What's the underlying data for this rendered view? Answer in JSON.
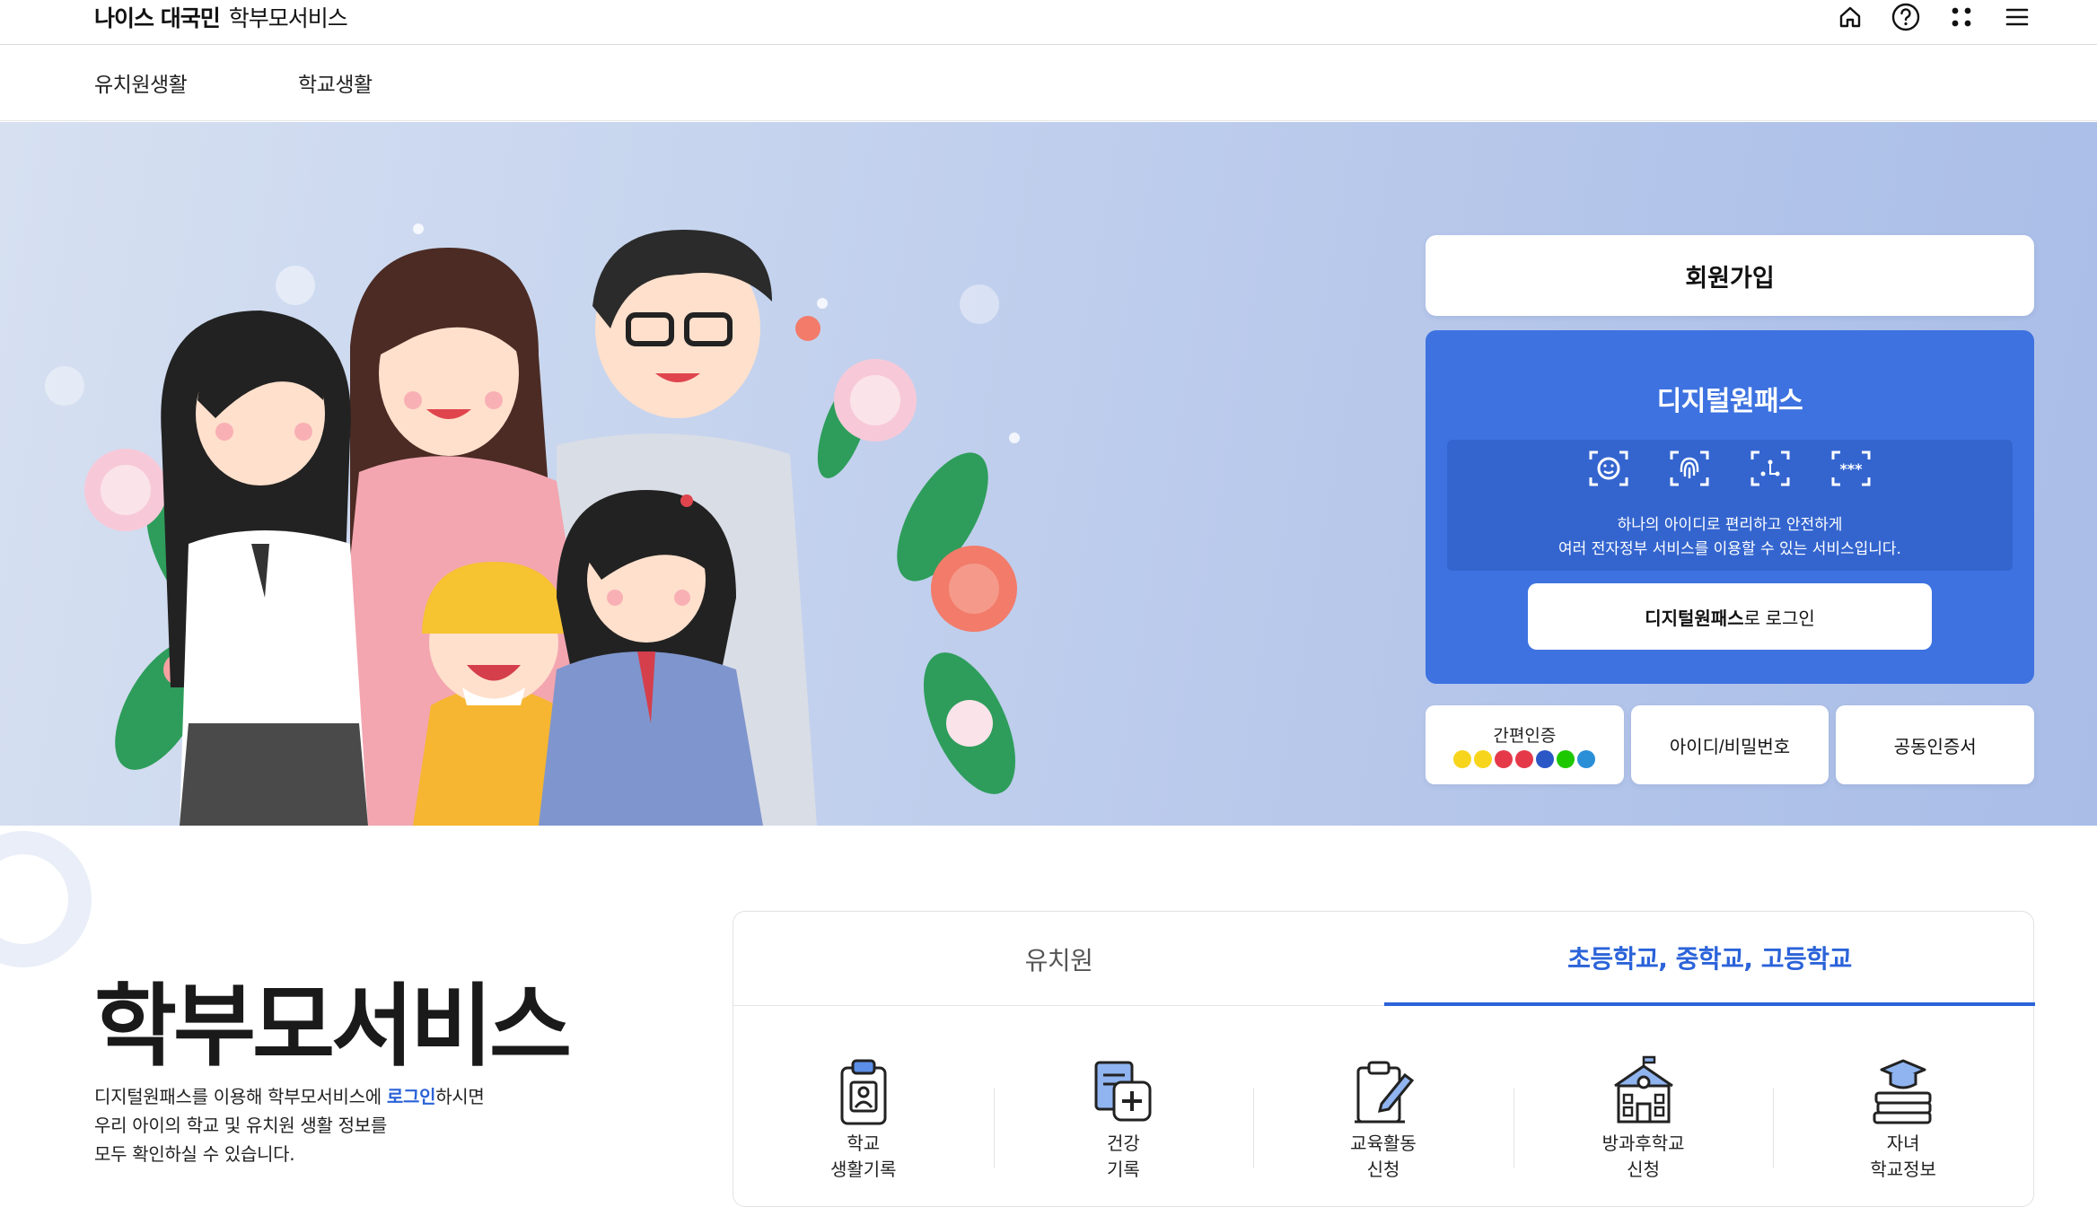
{
  "header": {
    "brand_bold": "나이스 대국민",
    "brand_light": "학부모서비스",
    "icons": [
      "home-icon",
      "help-icon",
      "apps-grid-icon",
      "menu-icon"
    ]
  },
  "subnav": {
    "items": [
      "유치원생활",
      "학교생활"
    ]
  },
  "login": {
    "signup_label": "회원가입",
    "onepass_title": "디지털원패스",
    "onepass_desc_line1": "하나의 아이디로 편리하고 안전하게",
    "onepass_desc_line2": "여러 전자정부 서비스를 이용할 수 있는 서비스입니다.",
    "onepass_login_bold": "디지털원패스",
    "onepass_login_rest": "로 로그인",
    "simple_auth_label": "간편인증",
    "id_pw_label": "아이디/비밀번호",
    "cert_label": "공동인증서",
    "accent_color": "#3d72e0"
  },
  "main": {
    "title": "학부모서비스",
    "desc_part1": "디지털원패스를 이용해 학부모서비스에 ",
    "desc_link": "로그인",
    "desc_part2": "하시면",
    "desc_line2": "우리 아이의 학교 및 유치원 생활 정보를",
    "desc_line3": "모두 확인하실 수 있습니다."
  },
  "services": {
    "tabs": [
      "유치원",
      "초등학교, 중학교, 고등학교"
    ],
    "active_tab": 1,
    "items": [
      {
        "line1": "학교",
        "line2": "생활기록",
        "icon": "school-record-icon"
      },
      {
        "line1": "건강",
        "line2": "기록",
        "icon": "health-record-icon"
      },
      {
        "line1": "교육활동",
        "line2": "신청",
        "icon": "activity-apply-icon"
      },
      {
        "line1": "방과후학교",
        "line2": "신청",
        "icon": "afterschool-icon"
      },
      {
        "line1": "자녀",
        "line2": "학교정보",
        "icon": "school-info-icon"
      }
    ]
  }
}
